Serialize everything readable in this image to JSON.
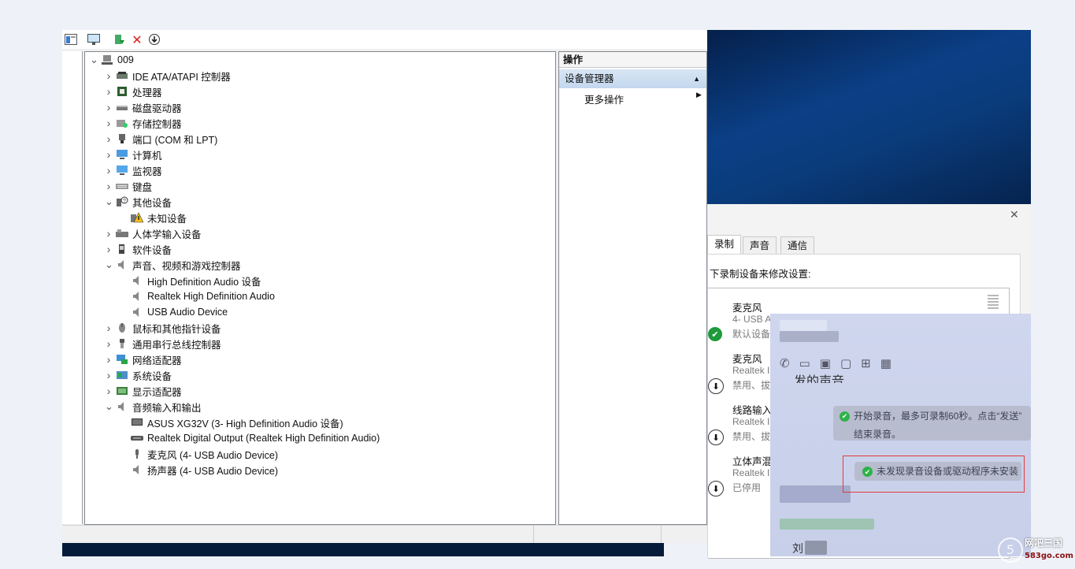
{
  "device_manager": {
    "toolbar": {
      "icons": [
        "console-tree-icon",
        "monitor-icon",
        "update-driver-icon",
        "uninstall-icon",
        "disable-icon"
      ]
    },
    "tree": [
      {
        "label": "009",
        "level": 0,
        "expanded": true,
        "icon": "computer-icon"
      },
      {
        "label": "IDE ATA/ATAPI 控制器",
        "level": 1,
        "expanded": false,
        "icon": "ide-icon"
      },
      {
        "label": "处理器",
        "level": 1,
        "expanded": false,
        "icon": "cpu-icon"
      },
      {
        "label": "磁盘驱动器",
        "level": 1,
        "expanded": false,
        "icon": "disk-icon"
      },
      {
        "label": "存储控制器",
        "level": 1,
        "expanded": false,
        "icon": "storage-icon"
      },
      {
        "label": "端口 (COM 和 LPT)",
        "level": 1,
        "expanded": false,
        "icon": "port-icon"
      },
      {
        "label": "计算机",
        "level": 1,
        "expanded": false,
        "icon": "pc-icon"
      },
      {
        "label": "监视器",
        "level": 1,
        "expanded": false,
        "icon": "monitor-icon"
      },
      {
        "label": "键盘",
        "level": 1,
        "expanded": false,
        "icon": "keyboard-icon"
      },
      {
        "label": "其他设备",
        "level": 1,
        "expanded": true,
        "icon": "unknown-device-icon"
      },
      {
        "label": "未知设备",
        "level": 2,
        "expanded": null,
        "icon": "warning-icon"
      },
      {
        "label": "人体学输入设备",
        "level": 1,
        "expanded": false,
        "icon": "hid-icon"
      },
      {
        "label": "软件设备",
        "level": 1,
        "expanded": false,
        "icon": "software-icon"
      },
      {
        "label": "声音、视频和游戏控制器",
        "level": 1,
        "expanded": true,
        "icon": "speaker-icon"
      },
      {
        "label": "High Definition Audio 设备",
        "level": 2,
        "expanded": null,
        "icon": "speaker-icon"
      },
      {
        "label": "Realtek High Definition Audio",
        "level": 2,
        "expanded": null,
        "icon": "speaker-icon"
      },
      {
        "label": "USB Audio Device",
        "level": 2,
        "expanded": null,
        "icon": "speaker-icon"
      },
      {
        "label": "鼠标和其他指针设备",
        "level": 1,
        "expanded": false,
        "icon": "mouse-icon"
      },
      {
        "label": "通用串行总线控制器",
        "level": 1,
        "expanded": false,
        "icon": "usb-icon"
      },
      {
        "label": "网络适配器",
        "level": 1,
        "expanded": false,
        "icon": "network-icon"
      },
      {
        "label": "系统设备",
        "level": 1,
        "expanded": false,
        "icon": "system-icon"
      },
      {
        "label": "显示适配器",
        "level": 1,
        "expanded": false,
        "icon": "display-adapter-icon"
      },
      {
        "label": "音频输入和输出",
        "level": 1,
        "expanded": true,
        "icon": "speaker-icon"
      },
      {
        "label": "ASUS XG32V (3- High Definition Audio 设备)",
        "level": 2,
        "expanded": null,
        "icon": "monitor-audio-icon"
      },
      {
        "label": "Realtek Digital Output (Realtek High Definition Audio)",
        "level": 2,
        "expanded": null,
        "icon": "digital-output-icon"
      },
      {
        "label": "麦克风 (4- USB Audio Device)",
        "level": 2,
        "expanded": null,
        "icon": "microphone-icon"
      },
      {
        "label": "扬声器 (4- USB Audio Device)",
        "level": 2,
        "expanded": null,
        "icon": "speaker-icon"
      }
    ],
    "actions": {
      "header": "操作",
      "selected": "设备管理器",
      "more": "更多操作"
    }
  },
  "sound_dialog": {
    "close": "✕",
    "tabs": [
      "录制",
      "声音",
      "通信"
    ],
    "instruction": "下录制设备来修改设置:",
    "devices": [
      {
        "name": "麦克风",
        "sub1": "4- USB A",
        "sub2": "默认设备",
        "status": "default"
      },
      {
        "name": "麦克风",
        "sub1": "Realtek I",
        "sub2": "禁用、拔",
        "status": "disabled"
      },
      {
        "name": "线路输入",
        "sub1": "Realtek I",
        "sub2": "禁用、拔",
        "status": "disabled"
      },
      {
        "name": "立体声混",
        "sub1": "Realtek I",
        "sub2": "已停用",
        "status": "disabled"
      }
    ]
  },
  "chat": {
    "fragment": "发的声音",
    "message1_line1": "开始录音，最多可录制60秒。点击“发送”",
    "message1_line2": "结束录音。",
    "message2": "未发现录音设备或驱动程序未安装",
    "name_fragment": "刘"
  },
  "watermark": {
    "line1": "网吧三国",
    "line2": "583go.com"
  },
  "colors": {
    "desktop": "#0b3f86",
    "selection": "#cce0f5",
    "highlight": "#e23b3b",
    "ok": "#2eb24a"
  }
}
